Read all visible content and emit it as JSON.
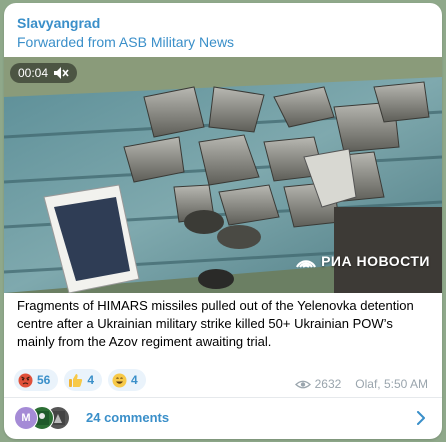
{
  "message": {
    "channel_name": "Slavyangrad",
    "forwarded_from": "Forwarded from ASB Military News",
    "video": {
      "duration": "00:04",
      "watermark_text": "РИА НОВОСТИ"
    },
    "caption": "Fragments of HIMARS missiles pulled out of the Yelenovka detention centre after a Ukrainian military strike killed 50+ Ukrainian POW’s mainly from the Azov regiment awaiting trial.",
    "reactions": [
      {
        "emoji": "angry-face",
        "count": "56"
      },
      {
        "emoji": "thumbs-up",
        "count": "4"
      },
      {
        "emoji": "grinning-face",
        "count": "4"
      }
    ],
    "views": "2632",
    "author_time": "Olaf, 5:50 AM",
    "comments": {
      "label": "24 comments",
      "avatar_letter": "M"
    }
  },
  "colors": {
    "accent": "#3a8fc9",
    "background": "#8fa88a",
    "reaction_bg": "#eaf3fb",
    "meta_text": "#9aa5ad"
  }
}
